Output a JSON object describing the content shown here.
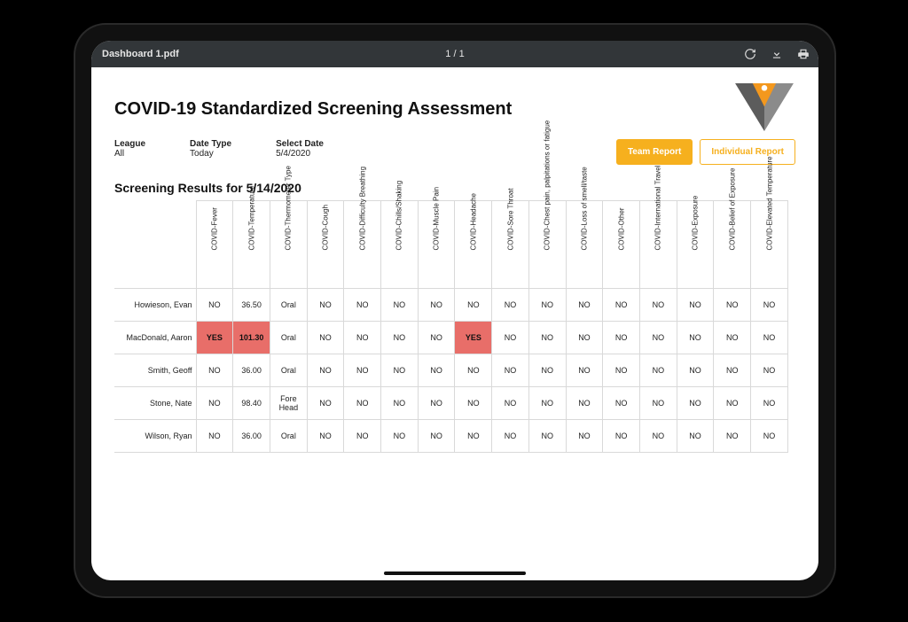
{
  "topbar": {
    "filename": "Dashboard 1.pdf",
    "page": "1 / 1"
  },
  "title": "COVID-19 Standardized Screening Assessment",
  "filters": {
    "league_label": "League",
    "league_value": "All",
    "datetype_label": "Date Type",
    "datetype_value": "Today",
    "selectdate_label": "Select Date",
    "selectdate_value": "5/4/2020"
  },
  "buttons": {
    "team_report": "Team Report",
    "individual_report": "Individual Report"
  },
  "section_title": "Screening Results for 5/14/2020",
  "columns": [
    "COVID-Fever",
    "COVID-Temperature",
    "COVID-Thermometer Type",
    "COVID-Cough",
    "COVID-Difficulty Breathing",
    "COVID-Chills/Shaking",
    "COVID-Muscle Pain",
    "COVID-Headache",
    "COVID-Sore Throat",
    "COVID-Chest pain, palpitations or fatigue",
    "COVID-Loss of smell/taste",
    "COVID-Other",
    "COVID-International Travel",
    "COVID-Exposure",
    "COVID-Belief of Exposure",
    "COVID-Elevated Temperature"
  ],
  "rows": [
    {
      "name": "Howieson, Evan",
      "cells": [
        "NO",
        "36.50",
        "Oral",
        "NO",
        "NO",
        "NO",
        "NO",
        "NO",
        "NO",
        "NO",
        "NO",
        "NO",
        "NO",
        "NO",
        "NO",
        "NO"
      ],
      "flags": []
    },
    {
      "name": "MacDonald, Aaron",
      "cells": [
        "YES",
        "101.30",
        "Oral",
        "NO",
        "NO",
        "NO",
        "NO",
        "YES",
        "NO",
        "NO",
        "NO",
        "NO",
        "NO",
        "NO",
        "NO",
        "NO"
      ],
      "flags": [
        0,
        1,
        7
      ]
    },
    {
      "name": "Smith, Geoff",
      "cells": [
        "NO",
        "36.00",
        "Oral",
        "NO",
        "NO",
        "NO",
        "NO",
        "NO",
        "NO",
        "NO",
        "NO",
        "NO",
        "NO",
        "NO",
        "NO",
        "NO"
      ],
      "flags": []
    },
    {
      "name": "Stone, Nate",
      "cells": [
        "NO",
        "98.40",
        "Fore Head",
        "NO",
        "NO",
        "NO",
        "NO",
        "NO",
        "NO",
        "NO",
        "NO",
        "NO",
        "NO",
        "NO",
        "NO",
        "NO"
      ],
      "flags": []
    },
    {
      "name": "Wilson, Ryan",
      "cells": [
        "NO",
        "36.00",
        "Oral",
        "NO",
        "NO",
        "NO",
        "NO",
        "NO",
        "NO",
        "NO",
        "NO",
        "NO",
        "NO",
        "NO",
        "NO",
        "NO"
      ],
      "flags": []
    }
  ]
}
